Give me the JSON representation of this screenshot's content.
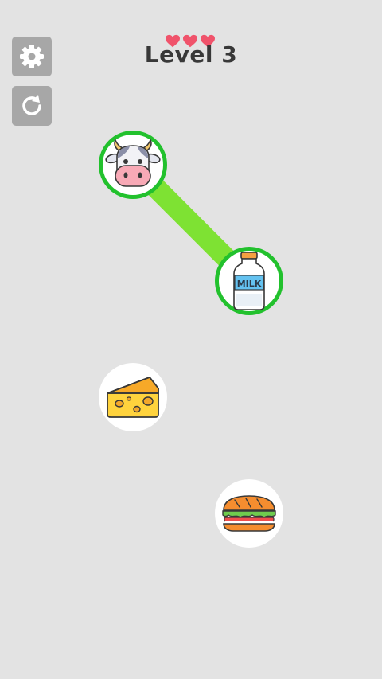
{
  "header": {
    "level_title": "Level 3",
    "hearts": 3,
    "heart_color": "#f0536b"
  },
  "toolbar": {
    "settings_icon": "gear-icon",
    "restart_icon": "restart-icon"
  },
  "board": {
    "accent_color": "#22c12d",
    "line_color": "#7ee233",
    "items": [
      {
        "name": "cow",
        "icon": "cow-icon",
        "selected": true
      },
      {
        "name": "milk",
        "icon": "milk-bottle-icon",
        "label": "MILK",
        "selected": true
      },
      {
        "name": "cheese",
        "icon": "cheese-icon",
        "selected": false
      },
      {
        "name": "sandwich",
        "icon": "sandwich-icon",
        "selected": false
      }
    ],
    "connections": [
      [
        "cow",
        "milk"
      ]
    ]
  }
}
